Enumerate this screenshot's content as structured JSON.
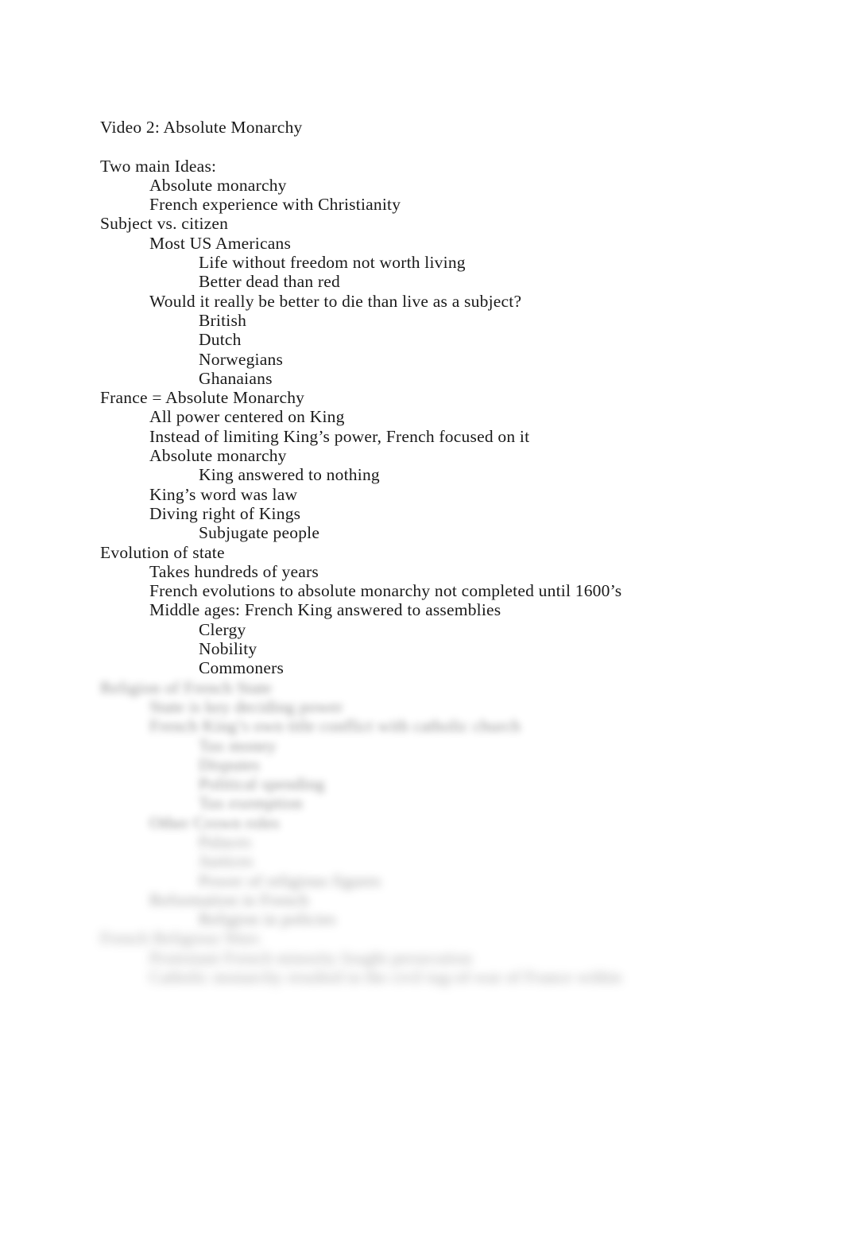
{
  "document": {
    "title": "Video 2: Absolute Monarchy",
    "page_background": "#ffffff",
    "text_color": "#1a1a1a",
    "lines": [
      {
        "id": "l1",
        "level": 0,
        "text": "Video 2: Absolute Monarchy",
        "blurred": false
      },
      {
        "id": "l2",
        "level": 0,
        "text": "",
        "blurred": false
      },
      {
        "id": "l3",
        "level": 0,
        "text": "Two main Ideas:",
        "blurred": false
      },
      {
        "id": "l4",
        "level": 1,
        "text": "Absolute monarchy",
        "blurred": false
      },
      {
        "id": "l5",
        "level": 1,
        "text": "French experience with Christianity",
        "blurred": false
      },
      {
        "id": "l6",
        "level": 0,
        "text": "Subject vs. citizen",
        "blurred": false
      },
      {
        "id": "l7",
        "level": 1,
        "text": "Most US Americans",
        "blurred": false
      },
      {
        "id": "l8",
        "level": 2,
        "text": "Life without freedom not worth living",
        "blurred": false
      },
      {
        "id": "l9",
        "level": 2,
        "text": "Better dead than red",
        "blurred": false
      },
      {
        "id": "l10",
        "level": 1,
        "text": "Would it really be better to die than live as a subject?",
        "blurred": false
      },
      {
        "id": "l11",
        "level": 2,
        "text": "British",
        "blurred": false
      },
      {
        "id": "l12",
        "level": 2,
        "text": "Dutch",
        "blurred": false
      },
      {
        "id": "l13",
        "level": 2,
        "text": "Norwegians",
        "blurred": false
      },
      {
        "id": "l14",
        "level": 2,
        "text": "Ghanaians",
        "blurred": false
      },
      {
        "id": "l15",
        "level": 0,
        "text": "France = Absolute Monarchy",
        "blurred": false
      },
      {
        "id": "l16",
        "level": 1,
        "text": "All power centered on King",
        "blurred": false
      },
      {
        "id": "l17",
        "level": 1,
        "text": "Instead of limiting King’s power, French focused on it",
        "blurred": false
      },
      {
        "id": "l18",
        "level": 1,
        "text": "Absolute monarchy",
        "blurred": false
      },
      {
        "id": "l19",
        "level": 2,
        "text": "King answered to nothing",
        "blurred": false
      },
      {
        "id": "l20",
        "level": 1,
        "text": "King’s word was law",
        "blurred": false
      },
      {
        "id": "l21",
        "level": 1,
        "text": "Diving right of Kings",
        "blurred": false
      },
      {
        "id": "l22",
        "level": 2,
        "text": "Subjugate people",
        "blurred": false
      },
      {
        "id": "l23",
        "level": 0,
        "text": "Evolution of state",
        "blurred": false
      },
      {
        "id": "l24",
        "level": 1,
        "text": "Takes hundreds of years",
        "blurred": false
      },
      {
        "id": "l25",
        "level": 1,
        "text": "French evolutions to absolute monarchy not completed until 1600’s",
        "blurred": false
      },
      {
        "id": "l26",
        "level": 1,
        "text": "Middle ages: French King answered to assemblies",
        "blurred": false
      },
      {
        "id": "l27",
        "level": 2,
        "text": "Clergy",
        "blurred": false
      },
      {
        "id": "l28",
        "level": 2,
        "text": "Nobility",
        "blurred": false
      },
      {
        "id": "l29",
        "level": 2,
        "text": "Commoners",
        "blurred": false
      },
      {
        "id": "l30",
        "level": 0,
        "text": "Religion of French State",
        "blurred": true
      },
      {
        "id": "l31",
        "level": 1,
        "text": "State is key deciding power",
        "blurred": true
      },
      {
        "id": "l32",
        "level": 1,
        "text": "French King’s own title conflict with catholic church",
        "blurred": true
      },
      {
        "id": "l33",
        "level": 2,
        "text": "Tax money",
        "blurred": true
      },
      {
        "id": "l34",
        "level": 2,
        "text": "Disputes",
        "blurred": true
      },
      {
        "id": "l35",
        "level": 2,
        "text": "Political spending",
        "blurred": true
      },
      {
        "id": "l36",
        "level": 2,
        "text": "Tax exemption",
        "blurred": true
      },
      {
        "id": "l37",
        "level": 1,
        "text": "Other Crown roles",
        "blurred": true
      },
      {
        "id": "l38",
        "level": 2,
        "text": "Palaces",
        "blurred": true
      },
      {
        "id": "l39",
        "level": 2,
        "text": "Justices",
        "blurred": true
      },
      {
        "id": "l40",
        "level": 2,
        "text": "Power of religious figures",
        "blurred": true
      },
      {
        "id": "l41",
        "level": 1,
        "text": "Reformation in French",
        "blurred": true
      },
      {
        "id": "l42",
        "level": 2,
        "text": "Religion in policies",
        "blurred": true
      },
      {
        "id": "l43",
        "level": 0,
        "text": "French Religious Wars",
        "blurred": true
      },
      {
        "id": "l44",
        "level": 1,
        "text": "Protestant French minority fought persecution",
        "blurred": true
      },
      {
        "id": "l45",
        "level": 1,
        "text": "Catholic monarchy resulted in the civil tug-of-war of France within",
        "blurred": true
      }
    ]
  }
}
